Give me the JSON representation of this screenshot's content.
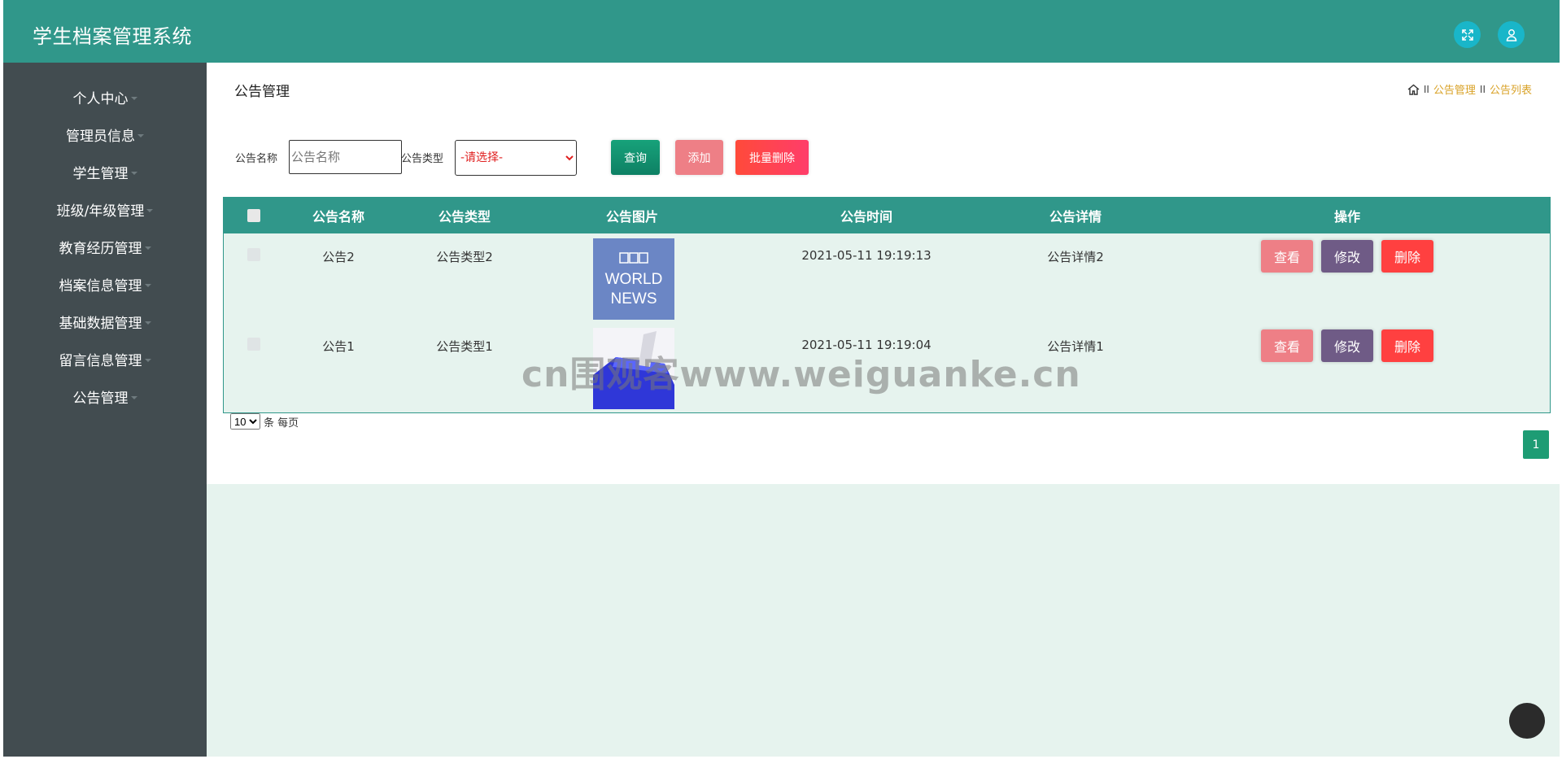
{
  "app": {
    "title": "学生档案管理系统"
  },
  "header": {
    "fullscreen_icon": "expand-icon",
    "user_icon": "user-icon",
    "accent": "#30978a"
  },
  "sidebar": {
    "items": [
      {
        "label": "个人中心"
      },
      {
        "label": "管理员信息"
      },
      {
        "label": "学生管理"
      },
      {
        "label": "班级/年级管理"
      },
      {
        "label": "教育经历管理"
      },
      {
        "label": "档案信息管理"
      },
      {
        "label": "基础数据管理"
      },
      {
        "label": "留言信息管理"
      },
      {
        "label": "公告管理"
      }
    ]
  },
  "page": {
    "title": "公告管理",
    "breadcrumb": {
      "sep1": "II",
      "item1": "公告管理",
      "sep2": "II",
      "item2": "公告列表"
    }
  },
  "search": {
    "name_label": "公告名称",
    "name_placeholder": "公告名称",
    "type_label": "公告类型",
    "type_selected": "-请选择-",
    "query_button": "查询",
    "add_button": "添加",
    "batch_delete_button": "批量删除"
  },
  "table": {
    "headers": [
      "公告名称",
      "公告类型",
      "公告图片",
      "公告时间",
      "公告详情",
      "操作"
    ],
    "rows": [
      {
        "name": "公告2",
        "type": "公告类型2",
        "image": "BBC WORLD NEWS",
        "time": "2021-05-11 19:19:13",
        "detail": "公告详情2",
        "view": "查看",
        "edit": "修改",
        "delete": "删除"
      },
      {
        "name": "公告1",
        "type": "公告类型1",
        "image": "keyboard-key",
        "time": "2021-05-11 19:19:04",
        "detail": "公告详情1",
        "view": "查看",
        "edit": "修改",
        "delete": "删除"
      }
    ]
  },
  "pagination": {
    "page_size": "10",
    "per_page_text": "条 每页",
    "current_page": "1"
  },
  "watermark": "cn围观客www.weiguanke.cn"
}
